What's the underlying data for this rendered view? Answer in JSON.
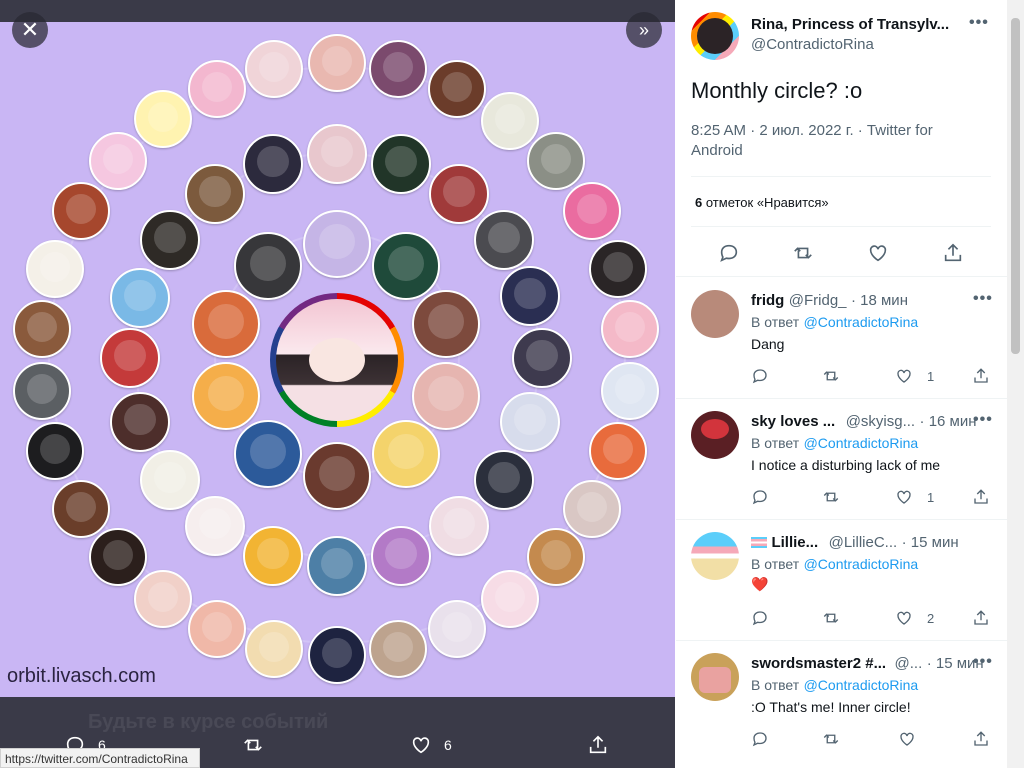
{
  "viewer": {
    "watermark": "orbit.livasch.com",
    "close_icon": "close-icon",
    "expand_icon": "double-chevron-right-icon",
    "bottom_bar": {
      "faint_text": "Будьте в курсе событий",
      "reply_count": "6",
      "like_count": "6"
    },
    "status_url": "https://twitter.com/ContradictoRina"
  },
  "tweet": {
    "author_name": "Rina, Princess of Transylv...",
    "author_handle": "@ContradictoRina",
    "text": "Monthly circle? :o",
    "meta": "8:25 AM · 2 июл. 2022 г. · Twitter for Android",
    "likes_count": "6",
    "likes_label": "отметок «Нравится»"
  },
  "replies": [
    {
      "name": "fridg",
      "handle": "@Fridg_",
      "time": "· 18 мин",
      "reply_to_label": "В ответ",
      "reply_to": "@ContradictoRina",
      "text": "Dang",
      "likes": "1",
      "avatar_color": "#b88a7a"
    },
    {
      "name": "sky loves ...",
      "handle": "@skyisg...",
      "time": "· 16 мин",
      "reply_to_label": "В ответ",
      "reply_to": "@ContradictoRina",
      "text": "I notice a disturbing lack of me",
      "likes": "1",
      "avatar_color": "#5a1f24"
    },
    {
      "name": "Lillie...",
      "handle": "@LillieC...",
      "time": "· 15 мин",
      "reply_to_label": "В ответ",
      "reply_to": "@ContradictoRina",
      "text": "❤️",
      "likes": "2",
      "avatar_color": "#f2dfa6"
    },
    {
      "name": "swordsmaster2 #...",
      "handle": "@...",
      "time": "· 15 мин",
      "reply_to_label": "В ответ",
      "reply_to": "@ContradictoRina",
      "text": ":O That's me! Inner circle!",
      "likes": "",
      "avatar_color": "#c9a15a"
    }
  ],
  "colors": {
    "accent": "#1d9bf0",
    "image_bg": "#c9b6f4",
    "bottom_bar": "#3a3a48"
  }
}
